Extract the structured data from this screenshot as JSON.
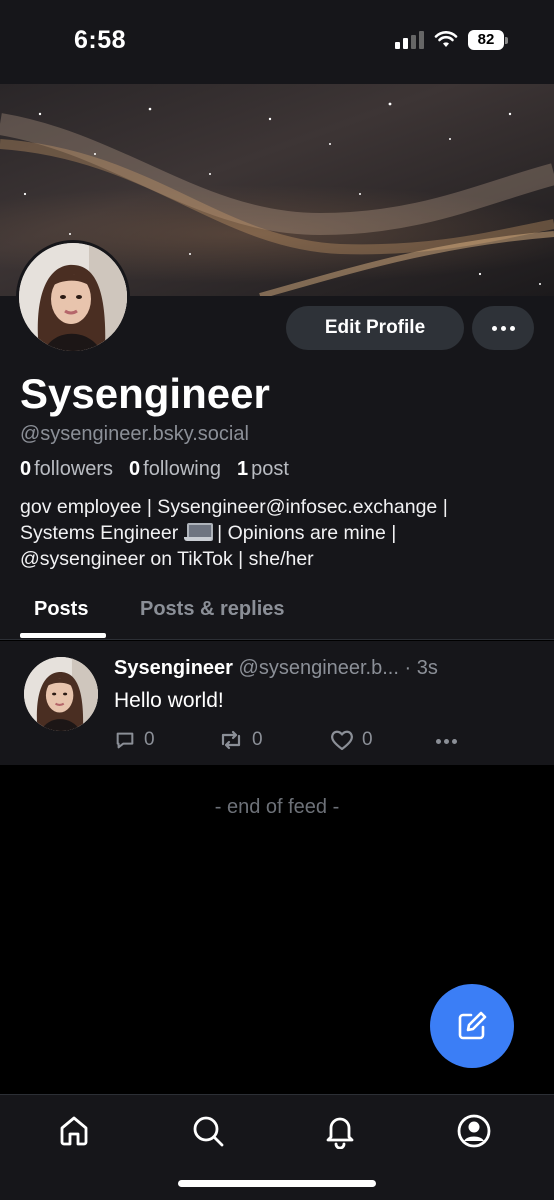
{
  "status_bar": {
    "time": "6:58",
    "battery": "82",
    "icons": [
      "signal-icon",
      "wifi-icon",
      "battery-icon"
    ]
  },
  "profile": {
    "display_name": "Sysengineer",
    "handle": "@sysengineer.bsky.social",
    "edit_button": "Edit Profile",
    "stats": {
      "followers_count": "0",
      "followers_label": "followers",
      "following_count": "0",
      "following_label": "following",
      "posts_count": "1",
      "posts_label": "post"
    },
    "bio_line1": "gov employee | Sysengineer@infosec.exchange |",
    "bio_line2_a": "Systems Engineer",
    "bio_line2_b": "| Opinions are mine |",
    "bio_line3": "@sysengineer on TikTok | she/her"
  },
  "tabs": [
    {
      "label": "Posts",
      "active": true
    },
    {
      "label": "Posts & replies",
      "active": false
    }
  ],
  "post": {
    "author": "Sysengineer",
    "handle": "@sysengineer.b...",
    "separator": "·",
    "time": "3s",
    "text": "Hello world!",
    "reply_count": "0",
    "repost_count": "0",
    "like_count": "0"
  },
  "feed_end": "- end of feed -",
  "colors": {
    "panel": "#16161a",
    "background": "#000000",
    "accent": "#3b7ef6",
    "muted": "#8b8f97"
  }
}
